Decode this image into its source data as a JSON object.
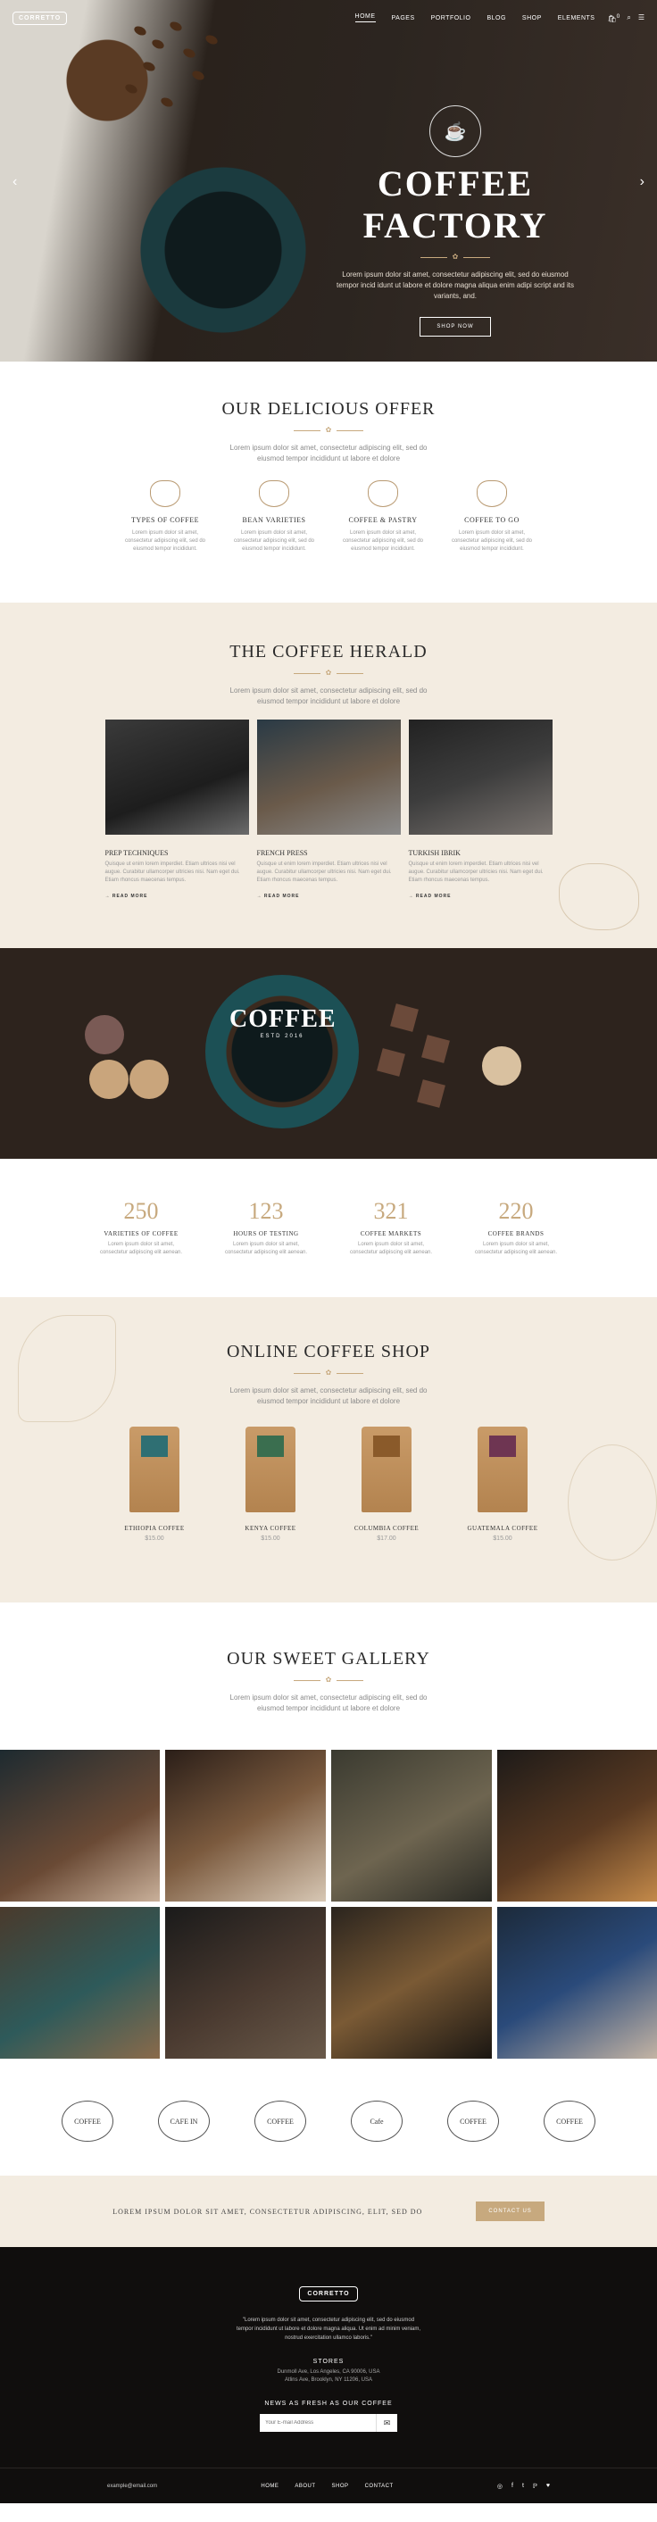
{
  "nav": {
    "logo": "CORRETTO",
    "items": [
      "HOME",
      "PAGES",
      "PORTFOLIO",
      "BLOG",
      "SHOP",
      "ELEMENTS"
    ],
    "cart_count": "0"
  },
  "hero": {
    "title": "COFFEE FACTORY",
    "text": "Lorem ipsum dolor sit amet, consectetur adipiscing elit, sed do eiusmod tempor incid idunt ut labore et dolore magna aliqua enim adipi script and its variants, and.",
    "button": "SHOP NOW",
    "arrow_left": "‹",
    "arrow_right": "›"
  },
  "offer": {
    "title": "OUR DELICIOUS OFFER",
    "subtitle": "Lorem ipsum dolor sit amet, consectetur adipiscing elit, sed do eiusmod tempor incididunt ut labore et dolore",
    "items": [
      {
        "title": "TYPES OF COFFEE",
        "text": "Lorem ipsum dolor sit amet, consectetur adipiscing elit, sed do eiusmod tempor incididunt."
      },
      {
        "title": "BEAN VARIETIES",
        "text": "Lorem ipsum dolor sit amet, consectetur adipiscing elit, sed do eiusmod tempor incididunt."
      },
      {
        "title": "COFFEE & PASTRY",
        "text": "Lorem ipsum dolor sit amet, consectetur adipiscing elit, sed do eiusmod tempor incididunt."
      },
      {
        "title": "COFFEE TO GO",
        "text": "Lorem ipsum dolor sit amet, consectetur adipiscing elit, sed do eiusmod tempor incididunt."
      }
    ]
  },
  "herald": {
    "title": "THE COFFEE HERALD",
    "subtitle": "Lorem ipsum dolor sit amet, consectetur adipiscing elit, sed do eiusmod tempor incididunt ut labore et dolore",
    "read_more": "READ MORE",
    "posts": [
      {
        "title": "PREP TECHNIQUES",
        "text": "Quisque ut enim lorem imperdiet. Etiam ultrices nisi vel augue. Curabitur ullamcorper ultricies nisi. Nam eget dui. Etiam rhoncus maecenas tempus."
      },
      {
        "title": "FRENCH PRESS",
        "text": "Quisque ut enim lorem imperdiet. Etiam ultrices nisi vel augue. Curabitur ullamcorper ultricies nisi. Nam eget dui. Etiam rhoncus maecenas tempus."
      },
      {
        "title": "TURKISH IBRIK",
        "text": "Quisque ut enim lorem imperdiet. Etiam ultrices nisi vel augue. Curabitur ullamcorper ultricies nisi. Nam eget dui. Etiam rhoncus maecenas tempus."
      }
    ]
  },
  "banner": {
    "logo_big": "COFFEE",
    "logo_small": "ESTD 2016"
  },
  "stats": [
    {
      "value": "250",
      "label": "VARIETIES OF COFFEE",
      "text": "Lorem ipsum dolor sit amet, consectetur adipiscing elit aenean."
    },
    {
      "value": "123",
      "label": "HOURS OF TESTING",
      "text": "Lorem ipsum dolor sit amet, consectetur adipiscing elit aenean."
    },
    {
      "value": "321",
      "label": "COFFEE MARKETS",
      "text": "Lorem ipsum dolor sit amet, consectetur adipiscing elit aenean."
    },
    {
      "value": "220",
      "label": "COFFEE BRANDS",
      "text": "Lorem ipsum dolor sit amet, consectetur adipiscing elit aenean."
    }
  ],
  "shop": {
    "title": "ONLINE COFFEE SHOP",
    "subtitle": "Lorem ipsum dolor sit amet, consectetur adipiscing elit, sed do eiusmod tempor incididunt ut labore et dolore",
    "products": [
      {
        "name": "ETHIOPIA COFFEE",
        "price": "$15.00",
        "label_color": "#2f6f73"
      },
      {
        "name": "KENYA COFFEE",
        "price": "$15.00",
        "label_color": "#3a6e4f"
      },
      {
        "name": "COLUMBIA COFFEE",
        "price": "$17.00",
        "label_color": "#8a5a2a"
      },
      {
        "name": "GUATEMALA COFFEE",
        "price": "$15.00",
        "label_color": "#6e3552"
      }
    ]
  },
  "gallery": {
    "title": "OUR SWEET GALLERY",
    "subtitle": "Lorem ipsum dolor sit amet, consectetur adipiscing elit, sed do eiusmod tempor incididunt ut labore et dolore"
  },
  "logos": [
    "COFFEE",
    "CAFE IN",
    "COFFEE",
    "Cafe",
    "COFFEE",
    "COFFEE"
  ],
  "cta": {
    "text": "LOREM IPSUM DOLOR SIT AMET, CONSECTETUR ADIPISCING, ELIT, SED DO",
    "button": "CONTACT US"
  },
  "footer": {
    "logo": "CORRETTO",
    "quote": "\"Lorem ipsum dolor sit amet, consectetur adipiscing elit, sed do eiusmod tempor incididunt ut labore et dolore magna aliqua. Ut enim ad minim veniam, nostrud exercitation ullamco laboris.\"",
    "stores_heading": "STORES",
    "stores": "Dunmoll Ave, Los Angeles, CA 90006, USA\nAtlins Ave, Brooklyn, NY 11206, USA",
    "news_heading": "NEWS AS FRESH AS OUR COFFEE",
    "email_placeholder": "Your E-mail Address",
    "send_icon": "✉",
    "email": "example@email.com",
    "bottom_nav": [
      "HOME",
      "ABOUT",
      "SHOP",
      "CONTACT"
    ],
    "social": [
      "◎",
      "f",
      "t",
      "ℙ",
      "♥"
    ]
  },
  "colors": {
    "accent": "#c7a97e",
    "beige": "#f3ece1",
    "dark": "#100e0d"
  }
}
